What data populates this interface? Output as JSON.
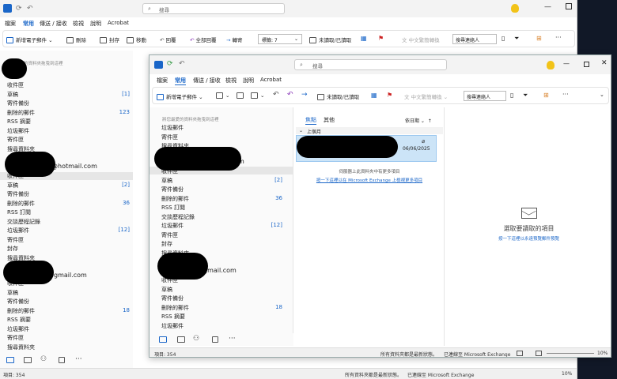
{
  "bg": {
    "search_placeholder": "搜尋",
    "menu": [
      "檔案",
      "常用",
      "傳送 / 接收",
      "檢視",
      "說明",
      "Acrobat"
    ],
    "ribbon": {
      "new_mail": "新增電子郵件",
      "delete": "刪除",
      "archive": "封存",
      "move": "移動",
      "reply": "回覆",
      "reply_all": "全部回覆",
      "forward": "轉寄",
      "tag_box": "標籤: 7",
      "unread": "未讀取/已讀取",
      "translate": "中文繁簡轉換",
      "search_people": "搜尋連絡人"
    },
    "hint": "將您最愛的資料夾拖曳到這裡",
    "folders1": [
      {
        "name": "收件匣",
        "count": ""
      },
      {
        "name": "草稿",
        "count": "[1]"
      },
      {
        "name": "寄件備份",
        "count": ""
      },
      {
        "name": "刪除的郵件",
        "count": "123"
      },
      {
        "name": "RSS 摘要",
        "count": ""
      },
      {
        "name": "垃圾郵件",
        "count": ""
      },
      {
        "name": "寄件匣",
        "count": ""
      },
      {
        "name": "搜尋資料夾",
        "count": ""
      }
    ],
    "account1_suffix": "@hotmail.com",
    "folders2": [
      {
        "name": "收件匣",
        "count": ""
      },
      {
        "name": "草稿",
        "count": "[2]"
      },
      {
        "name": "寄件備份",
        "count": ""
      },
      {
        "name": "刪除的郵件",
        "count": "36"
      },
      {
        "name": "RSS 訂閱",
        "count": ""
      },
      {
        "name": "交談歷程記錄",
        "count": ""
      },
      {
        "name": "垃圾郵件",
        "count": "[12]"
      },
      {
        "name": "寄件匣",
        "count": ""
      },
      {
        "name": "封存",
        "count": ""
      },
      {
        "name": "搜尋資料夾",
        "count": ""
      }
    ],
    "account2_suffix": "@gmail.com",
    "folders3": [
      {
        "name": "收件匣",
        "count": ""
      },
      {
        "name": "草稿",
        "count": ""
      },
      {
        "name": "寄件備份",
        "count": ""
      },
      {
        "name": "刪除的郵件",
        "count": "18"
      },
      {
        "name": "RSS 摘要",
        "count": ""
      },
      {
        "name": "垃圾郵件",
        "count": ""
      },
      {
        "name": "寄件匣",
        "count": ""
      },
      {
        "name": "搜尋資料夾",
        "count": ""
      }
    ],
    "status_items": "項目: 354",
    "status_right": "所有資料夾都是最新狀態。",
    "status_conn": "已連線至 Microsoft Exchange",
    "zoom": "10%"
  },
  "fg": {
    "search_placeholder": "搜尋",
    "menu": [
      "檔案",
      "常用",
      "傳送 / 接收",
      "檢視",
      "說明",
      "Acrobat"
    ],
    "ribbon": {
      "new_mail": "新增電子郵件",
      "unread": "未讀取/已讀取",
      "translate": "中文繁簡轉換",
      "search_people": "搜尋連絡人"
    },
    "hint": "將您最愛的資料夾拖曳到這裡",
    "folders1": [
      {
        "name": "垃圾郵件",
        "count": ""
      },
      {
        "name": "寄件匣",
        "count": ""
      },
      {
        "name": "搜尋資料夾",
        "count": ""
      }
    ],
    "account1_suffix": "m",
    "folders2": [
      {
        "name": "收件匣",
        "count": ""
      },
      {
        "name": "草稿",
        "count": "[2]"
      },
      {
        "name": "寄件備份",
        "count": ""
      },
      {
        "name": "刪除的郵件",
        "count": "36"
      },
      {
        "name": "RSS 訂閱",
        "count": ""
      },
      {
        "name": "交談歷程記錄",
        "count": ""
      },
      {
        "name": "垃圾郵件",
        "count": "[12]"
      },
      {
        "name": "寄件匣",
        "count": ""
      },
      {
        "name": "封存",
        "count": ""
      },
      {
        "name": "搜尋資料夾",
        "count": ""
      }
    ],
    "account2_suffix": "gmail.com",
    "folders3": [
      {
        "name": "收件匣",
        "count": ""
      },
      {
        "name": "草稿",
        "count": ""
      },
      {
        "name": "寄件備份",
        "count": ""
      },
      {
        "name": "刪除的郵件",
        "count": "18"
      },
      {
        "name": "RSS 摘要",
        "count": ""
      },
      {
        "name": "垃圾郵件",
        "count": ""
      }
    ],
    "tab_focused": "焦點",
    "tab_other": "其他",
    "sort_label": "依日期",
    "group_label": "上個月",
    "mail_date": "06/06/2025",
    "server_note": "伺服器上此資料夾中有更多項目",
    "server_link": "按一下這裡以在 Microsoft Exchange 上檢視更多項目",
    "reading_title": "選取要讀取的項目",
    "reading_link": "按一下這裡以永遠預覽郵件預覽",
    "status_items": "項目: 354",
    "status_right": "所有資料夾都是最新狀態。",
    "status_conn": "已連線至 Microsoft Exchange",
    "zoom": "10%"
  },
  "colors": {
    "accent": "#1a66c8",
    "mail_selected": "#cce4f7"
  }
}
